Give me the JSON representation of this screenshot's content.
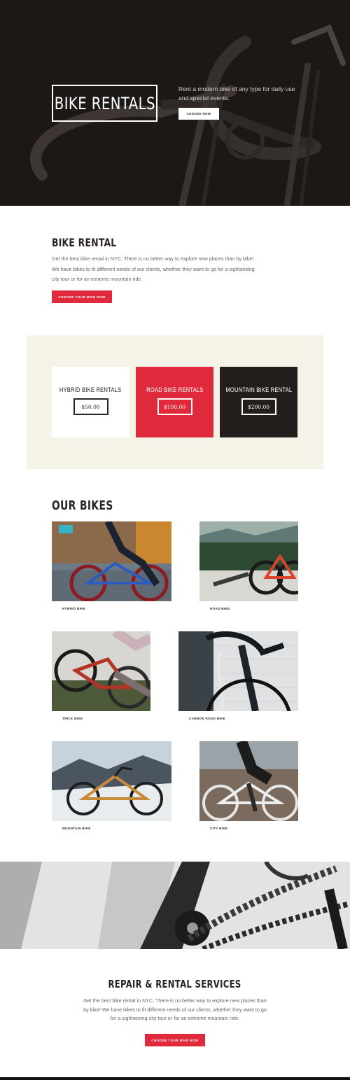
{
  "hero": {
    "title": "BIKE RENTALS",
    "description": "Rent a modern bike of any type for daily use and special events.",
    "cta": "CHOOSE NOW"
  },
  "about": {
    "title": "BIKE RENTAL",
    "text": "Get the best bike rental in NYC. There is no better way to explore new places than by bike! We have bikes to fit different needs of our clients, whether they want to go for a sightseeing city tour or for an extreme mountain ride.",
    "cta": "CHOOSE YOUR BIKE NOW"
  },
  "pricing": {
    "cards": [
      {
        "title": "HYBRID BIKE RENTALS",
        "price": "$50.00",
        "theme": "light"
      },
      {
        "title": "ROAD BIKE RENTALS",
        "price": "$100.00",
        "theme": "red"
      },
      {
        "title": "MOUNTAIN BIKE RENTAL",
        "price": "$200.00",
        "theme": "dark"
      }
    ]
  },
  "bikes": {
    "title": "OUR BIKES",
    "items": [
      {
        "label": "HYBRID BIKE"
      },
      {
        "label": "ROAD BIKE"
      },
      {
        "label": "TRICK BIKE"
      },
      {
        "label": "CARBON ROAD BIKE"
      },
      {
        "label": "MOUNTAIN BIKE"
      },
      {
        "label": "CITY BIKE"
      }
    ]
  },
  "services": {
    "title": "REPAIR & RENTAL SERVICES",
    "text": "Get the best bike rental in NYC. There is no better way to explore new places than by bike! We have bikes to fit different needs of our clients, whether they want to go for a sightseeing city tour or for an extreme mountain ride.",
    "cta": "CHOOSE YOUR BIKE NOW"
  },
  "colors": {
    "accent_red": "#e02a3c",
    "dark": "#231d1b",
    "cream": "#f5f3e8"
  }
}
